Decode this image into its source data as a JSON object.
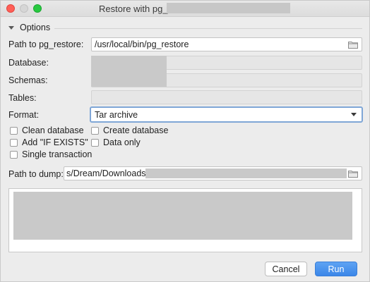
{
  "window": {
    "title": "Restore with pg_restore"
  },
  "options": {
    "header": "Options"
  },
  "form": {
    "path_to_pg_restore_label": "Path to pg_restore:",
    "path_to_pg_restore_value": "/usr/local/bin/pg_restore",
    "database_label": "Database:",
    "schemas_label": "Schemas:",
    "tables_label": "Tables:",
    "format_label": "Format:",
    "format_value": "Tar archive"
  },
  "checkboxes": {
    "clean_database": "Clean database",
    "create_database": "Create database",
    "add_if_exists": "Add \"IF EXISTS\"",
    "data_only": "Data only",
    "single_transaction": "Single transaction"
  },
  "dump": {
    "label": "Path to dump:",
    "value": "s/Dream/Downloads/"
  },
  "buttons": {
    "cancel": "Cancel",
    "run": "Run"
  },
  "icons": {
    "folder": "folder-icon",
    "dropdown": "chevron-down-icon",
    "collapse": "triangle-down-icon"
  },
  "colors": {
    "primary_button": "#3b86e8",
    "focus_border": "#7fa6d6",
    "close": "#ff5f57",
    "maximize": "#28c840"
  }
}
